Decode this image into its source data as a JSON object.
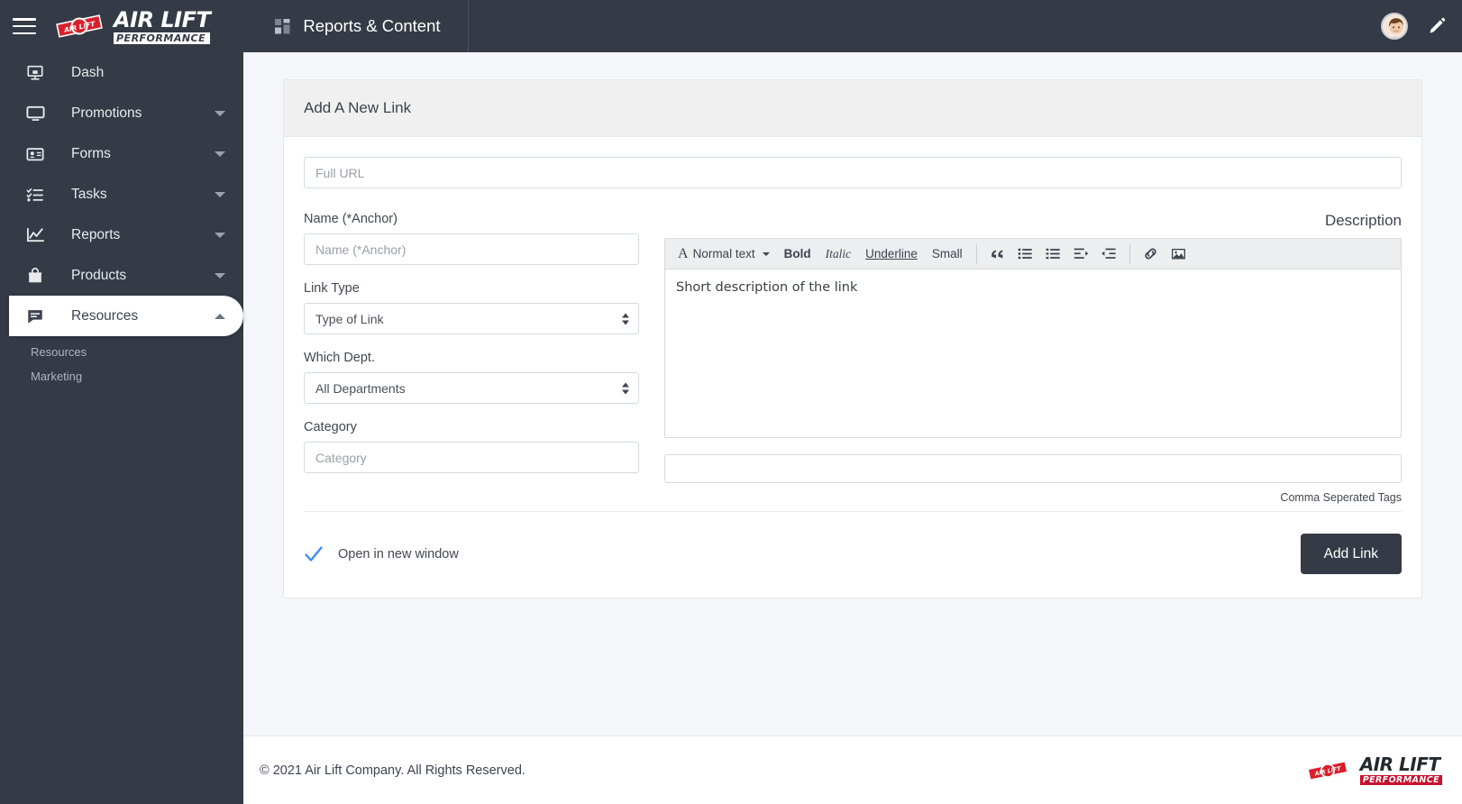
{
  "header": {
    "menu_icon": "hamburger-icon",
    "brand_badge": "air-lift-badge-logo",
    "brand_top": "AIR LIFT",
    "brand_bottom": "PERFORMANCE",
    "grid_icon": "grid-icon",
    "page_title": "Reports & Content",
    "avatar": "user-avatar",
    "edit_icon": "pencil-icon"
  },
  "sidebar": {
    "items": [
      {
        "label": "Dash",
        "icon": "desktop-icon",
        "has_caret": false,
        "active": false
      },
      {
        "label": "Promotions",
        "icon": "monitor-icon",
        "has_caret": true,
        "active": false
      },
      {
        "label": "Forms",
        "icon": "id-card-icon",
        "has_caret": true,
        "active": false
      },
      {
        "label": "Tasks",
        "icon": "checklist-icon",
        "has_caret": true,
        "active": false
      },
      {
        "label": "Reports",
        "icon": "chart-line-icon",
        "has_caret": true,
        "active": false
      },
      {
        "label": "Products",
        "icon": "bag-icon",
        "has_caret": true,
        "active": false
      },
      {
        "label": "Resources",
        "icon": "comment-icon",
        "has_caret": true,
        "active": true
      }
    ],
    "subitems": [
      {
        "label": "Resources"
      },
      {
        "label": "Marketing"
      }
    ]
  },
  "card": {
    "title": "Add A New Link",
    "url_placeholder": "Full URL",
    "url_value": "",
    "fields": {
      "name": {
        "label": "Name (*Anchor)",
        "placeholder": "Name (*Anchor)",
        "value": ""
      },
      "link_type": {
        "label": "Link Type",
        "selected": "Type of Link"
      },
      "department": {
        "label": "Which Dept.",
        "selected": "All Departments"
      },
      "category": {
        "label": "Category",
        "placeholder": "Category",
        "value": ""
      }
    },
    "description": {
      "label": "Description",
      "toolbar": {
        "style_glyph": "A",
        "style_label": "Normal text",
        "bold": "Bold",
        "italic": "Italic",
        "underline": "Underline",
        "small": "Small",
        "icons": [
          "blockquote-icon",
          "unordered-list-icon",
          "ordered-list-icon",
          "indent-icon",
          "outdent-icon",
          "link-icon",
          "image-icon"
        ]
      },
      "body_text": "Short description of the link"
    },
    "tags": {
      "value": "",
      "placeholder": "",
      "hint": "Comma Seperated Tags"
    },
    "open_new_window": {
      "label": "Open in new window",
      "checked": true,
      "check_color": "#3d8bfd"
    },
    "submit_label": "Add Link"
  },
  "footer": {
    "copyright": "© 2021 Air Lift Company. All Rights Reserved.",
    "badge": "air-lift-badge-logo",
    "wordmark_top": "AIR LIFT",
    "wordmark_bottom": "PERFORMANCE"
  },
  "colors": {
    "dark": "#343b46",
    "page_bg": "#f4f6f9",
    "accent_red": "#c8102e",
    "check_blue": "#3d8bfd"
  }
}
